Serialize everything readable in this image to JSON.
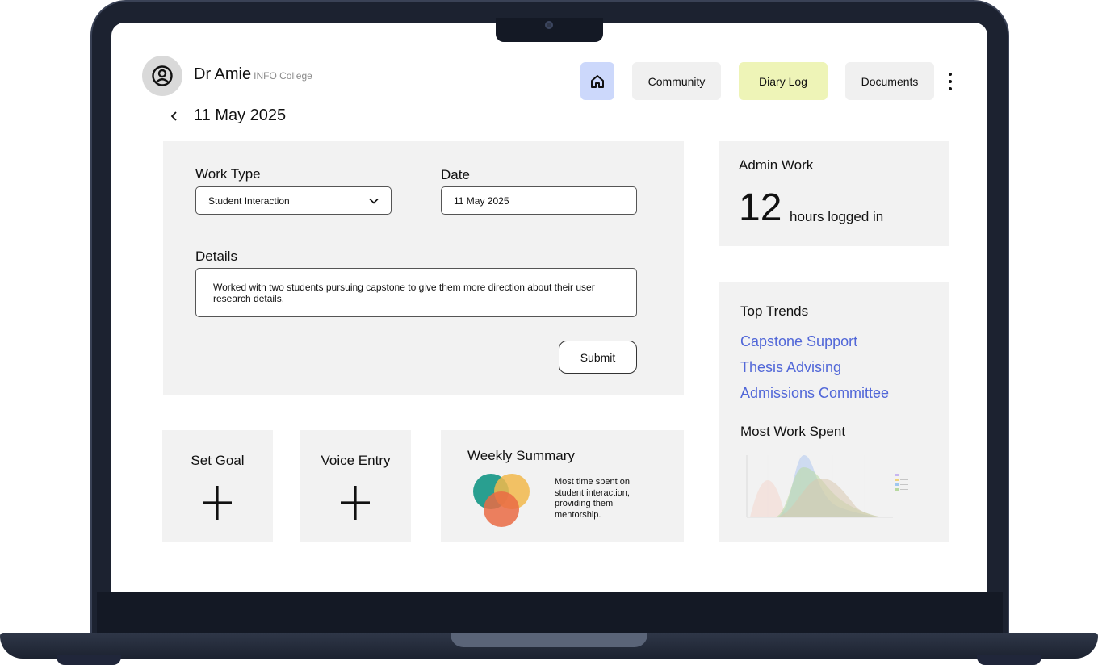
{
  "user": {
    "name": "Dr Amie",
    "org": "INFO College"
  },
  "nav": {
    "home_icon": "home-icon",
    "items": [
      {
        "label": "Community"
      },
      {
        "label": "Diary Log",
        "active_color": "#eef4b7"
      },
      {
        "label": "Documents"
      }
    ],
    "more_icon": "kebab-menu-icon",
    "home_color": "#ccd8fb"
  },
  "page": {
    "date": "11 May 2025",
    "back_icon": "chevron-left-icon"
  },
  "form": {
    "work_type_label": "Work Type",
    "work_type_value": "Student Interaction",
    "date_label": "Date",
    "date_value": "11 May 2025",
    "details_label": "Details",
    "details_value": "Worked with two students pursuing capstone to give them more direction about their user research details.",
    "submit_label": "Submit"
  },
  "tiles": {
    "goal": {
      "title": "Set Goal",
      "icon": "plus-icon"
    },
    "voice": {
      "title": "Voice Entry",
      "icon": "plus-icon"
    }
  },
  "weekly_summary": {
    "title": "Weekly Summary",
    "text": "Most time spent on student interaction, providing them mentorship.",
    "icon": "venn-diagram-icon"
  },
  "admin_work": {
    "title": "Admin Work",
    "hours": "12",
    "suffix": "hours logged in"
  },
  "top_trends": {
    "title": "Top Trends",
    "items": [
      "Capstone Support",
      "Thesis Advising",
      "Admissions Committee"
    ],
    "link_color": "#5167d8"
  },
  "most_work": {
    "title": "Most Work Spent",
    "chart_icon": "density-chart-thumbnail"
  }
}
